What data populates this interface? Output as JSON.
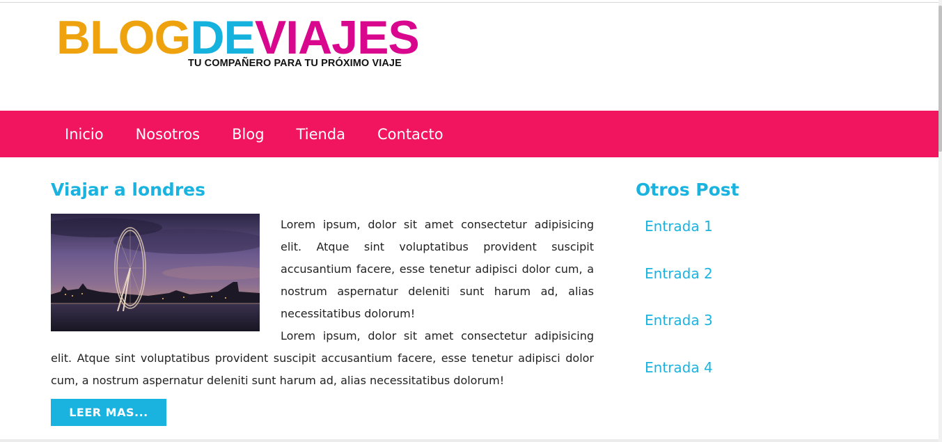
{
  "colors": {
    "accent": "#f1155f",
    "link": "#1ab3e0",
    "logo_orange": "#eda20e",
    "logo_cyan": "#16b2de",
    "logo_magenta": "#d8078e"
  },
  "header": {
    "logo": {
      "part1": "BLOG",
      "part2": "DE",
      "part3": "VIAJES",
      "tagline": "TU COMPAÑERO PARA TU PRÓXIMO VIAJE"
    }
  },
  "nav": {
    "items": [
      {
        "label": "Inicio"
      },
      {
        "label": "Nosotros"
      },
      {
        "label": "Blog"
      },
      {
        "label": "Tienda"
      },
      {
        "label": "Contacto"
      }
    ]
  },
  "post": {
    "title": "Viajar a londres",
    "image": {
      "subject": "london-eye-at-dusk"
    },
    "paragraphs": [
      "Lorem ipsum, dolor sit amet consectetur adipisicing elit. Atque sint voluptatibus provident suscipit accusantium facere, esse tenetur adipisci dolor cum, a nostrum aspernatur deleniti sunt harum ad, alias necessitatibus dolorum!",
      "Lorem ipsum, dolor sit amet consectetur adipisicing elit. Atque sint voluptatibus provident suscipit accusantium facere, esse tenetur adipisci dolor cum, a nostrum aspernatur deleniti sunt harum ad, alias necessitatibus dolorum!"
    ],
    "read_more": "LEER MAS..."
  },
  "sidebar": {
    "title": "Otros Post",
    "entries": [
      {
        "label": "Entrada 1"
      },
      {
        "label": "Entrada 2"
      },
      {
        "label": "Entrada 3"
      },
      {
        "label": "Entrada 4"
      }
    ]
  }
}
